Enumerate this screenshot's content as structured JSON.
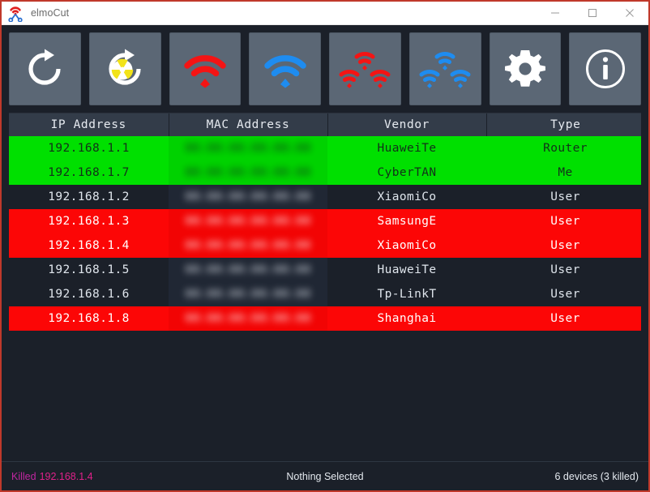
{
  "window": {
    "title": "elmoCut",
    "app_icon": "elmocut-scissors-wifi-icon",
    "controls": {
      "minimize": "minimize-icon",
      "maximize": "maximize-icon",
      "close": "close-icon"
    },
    "accent_color": "#c0392b",
    "background_color": "#1b2029"
  },
  "toolbar": {
    "buttons": [
      {
        "name": "refresh",
        "icon": "refresh-icon",
        "title": "Refresh"
      },
      {
        "name": "force-refresh",
        "icon": "nuclear-refresh-icon",
        "title": "Force Refresh"
      },
      {
        "name": "kill",
        "icon": "wifi-red-icon",
        "title": "Kill"
      },
      {
        "name": "unkill",
        "icon": "wifi-blue-icon",
        "title": "Unkill"
      },
      {
        "name": "kill-all",
        "icon": "wifi-multi-red-icon",
        "title": "Kill All"
      },
      {
        "name": "unkill-all",
        "icon": "wifi-multi-blue-icon",
        "title": "Unkill All"
      },
      {
        "name": "settings",
        "icon": "gear-icon",
        "title": "Settings"
      },
      {
        "name": "about",
        "icon": "info-icon",
        "title": "About"
      }
    ]
  },
  "table": {
    "columns": [
      "IP Address",
      "MAC Address",
      "Vendor",
      "Type"
    ],
    "rows": [
      {
        "ip": "192.168.1.1",
        "mac": "00:00:00:00:00:00",
        "vendor": "HuaweiTe",
        "type": "Router",
        "state": "router"
      },
      {
        "ip": "192.168.1.7",
        "mac": "00:00:00:00:00:00",
        "vendor": "CyberTAN",
        "type": "Me",
        "state": "me"
      },
      {
        "ip": "192.168.1.2",
        "mac": "00:00:00:00:00:00",
        "vendor": "XiaomiCo",
        "type": "User",
        "state": "normal"
      },
      {
        "ip": "192.168.1.3",
        "mac": "00:00:00:00:00:00",
        "vendor": "SamsungE",
        "type": "User",
        "state": "killed"
      },
      {
        "ip": "192.168.1.4",
        "mac": "00:00:00:00:00:00",
        "vendor": "XiaomiCo",
        "type": "User",
        "state": "killed"
      },
      {
        "ip": "192.168.1.5",
        "mac": "00:00:00:00:00:00",
        "vendor": "HuaweiTe",
        "type": "User",
        "state": "normal"
      },
      {
        "ip": "192.168.1.6",
        "mac": "00:00:00:00:00:00",
        "vendor": "Tp-LinkT",
        "type": "User",
        "state": "normal"
      },
      {
        "ip": "192.168.1.8",
        "mac": "00:00:00:00:00:00",
        "vendor": "Shanghai",
        "type": "User",
        "state": "killed"
      }
    ]
  },
  "statusbar": {
    "left_keyword": "Killed",
    "left_ip": "192.168.1.4",
    "center": "Nothing Selected",
    "right": "6 devices (3 killed)",
    "killed_color": "#c026a0",
    "ip_color": "#e0218a"
  }
}
